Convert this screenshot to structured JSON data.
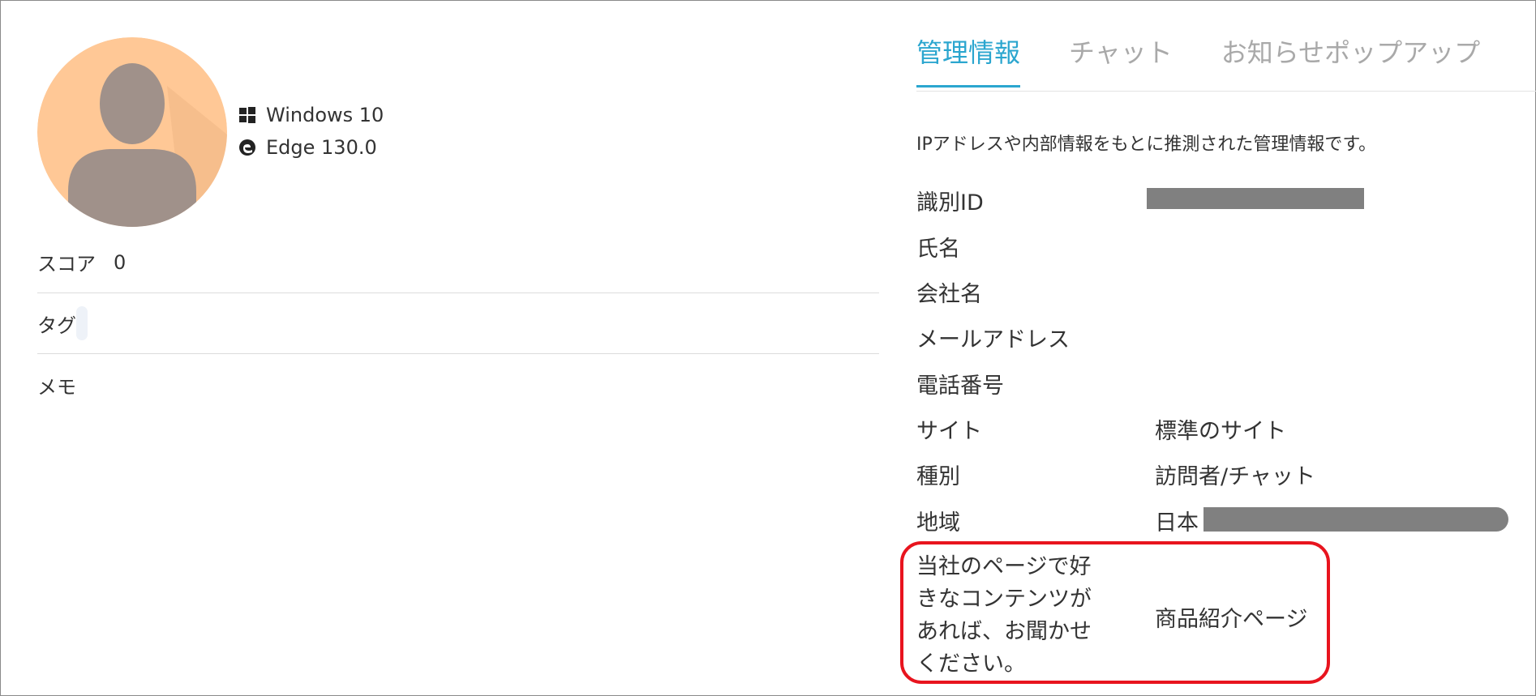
{
  "profile": {
    "os": "Windows 10",
    "browser": "Edge 130.0",
    "score_label": "スコア",
    "score_value": "0",
    "tag_label": "タグ",
    "memo_label": "メモ"
  },
  "tabs": [
    {
      "label": "管理情報",
      "active": true
    },
    {
      "label": "チャット",
      "active": false
    },
    {
      "label": "お知らせポップアップ",
      "active": false
    }
  ],
  "info": {
    "description": "IPアドレスや内部情報をもとに推測された管理情報です。",
    "rows": [
      {
        "label": "識別ID",
        "value": ""
      },
      {
        "label": "氏名",
        "value": ""
      },
      {
        "label": "会社名",
        "value": ""
      },
      {
        "label": "メールアドレス",
        "value": ""
      },
      {
        "label": "電話番号",
        "value": ""
      },
      {
        "label": "サイト",
        "value": "標準のサイト"
      },
      {
        "label": "種別",
        "value": "訪問者/チャット"
      },
      {
        "label": "地域",
        "value": "日本"
      }
    ],
    "survey": {
      "question": "当社のページで好きなコンテンツがあれば、お聞かせください。",
      "answer": "商品紹介ページ"
    }
  },
  "colors": {
    "accent": "#2ba6cf",
    "highlight": "#e8141e",
    "avatar_bg": "#ffc896",
    "avatar_figure": "#a0918a"
  },
  "icons": {
    "os": "windows-icon",
    "browser": "edge-icon"
  }
}
